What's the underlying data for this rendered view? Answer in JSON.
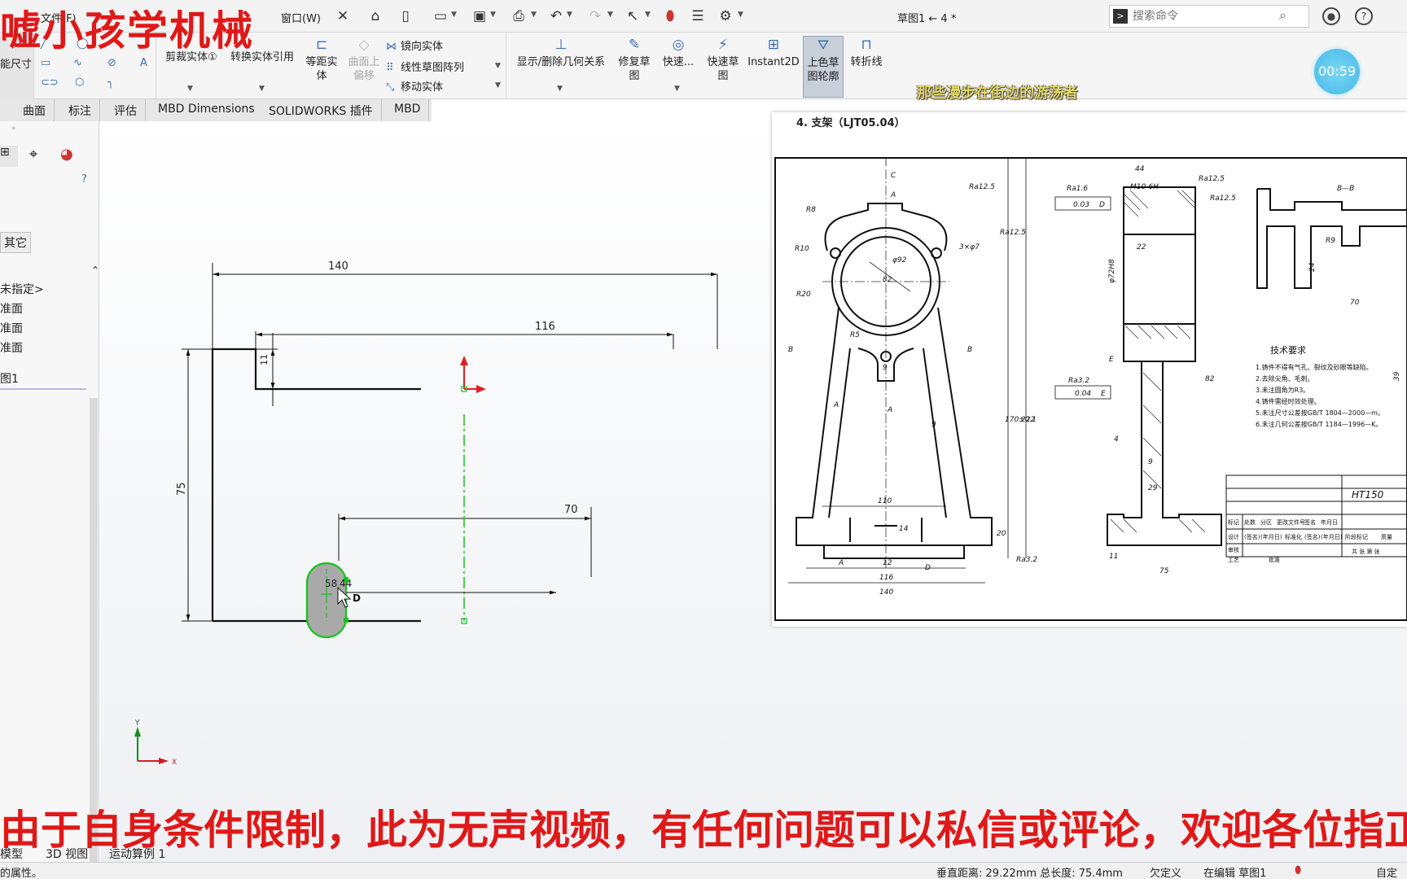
{
  "titlebar": {
    "menu_file": "文件(F)",
    "menu_window": "窗口(W)",
    "document_title": "草图1 ← 4 *",
    "search_placeholder": "搜索命令"
  },
  "overlay": {
    "brand": "嘘小孩学机械",
    "timer": "00:59",
    "lyric": "那些漫步在街边的游荡者",
    "bottom_notice": "由于自身条件限制，此为无声视频，有任何问题可以私信或评论，欢迎各位指正"
  },
  "ribbon": {
    "smart_dimension": "能尺寸",
    "trim_entities": "剪裁实体①",
    "convert_entities": "转换实体引用",
    "offset_entities": "等距实体",
    "offset_on_surface": "曲面上偏移",
    "mirror_entities": "镜向实体",
    "linear_pattern": "线性草图阵列",
    "move_entities": "移动实体",
    "display_relations": "显示/删除几何关系",
    "repair_sketch": "修复草图",
    "quick_snaps": "快速...",
    "rapid_sketch": "快速草图",
    "instant2d": "Instant2D",
    "shaded_sketch": "上色草图轮廓",
    "jog_line": "转折线"
  },
  "tabs": [
    "曲面",
    "标注",
    "评估",
    "MBD Dimensions",
    "SOLIDWORKS 插件",
    "MBD"
  ],
  "left_panel": {
    "other_tab": "其它",
    "tree": [
      "未指定>",
      "准面",
      "准面",
      "准面",
      "图1"
    ]
  },
  "sketch": {
    "dims": {
      "d140": "140",
      "d116": "116",
      "d70": "70",
      "d75": "75",
      "d11": "11",
      "d58": "58",
      "d44": "44"
    },
    "cursor_label": "D"
  },
  "reference_drawing": {
    "title": "4. 支架（LJT05.04）",
    "section_label": "B—B",
    "tech_req_title": "技术要求",
    "tech_req": [
      "1.铸件不得有气孔、裂纹及砂眼等缺陷。",
      "2.去除尖角、毛刺。",
      "3.未注圆角为R3。",
      "4.铸件需经时效处理。",
      "5.未注尺寸公差按GB/T 1804—2000—m。",
      "6.未注几何公差按GB/T 1184—1996—K。"
    ],
    "material": "HT150",
    "labels": {
      "c": "C",
      "a": "A",
      "b": "B",
      "d": "D",
      "e": "E",
      "ra125": "Ra12.5",
      "ra16": "Ra1.6",
      "ra32": "Ra3.2",
      "r8": "R8",
      "r10": "R10",
      "r20": "R20",
      "r5": "R5",
      "r9": "R9",
      "phi92": "φ92",
      "n82": "82",
      "holes": "3×φ7",
      "n9": "9",
      "n110": "110",
      "n14": "14",
      "n12": "12",
      "n116": "116",
      "n140": "140",
      "n20": "20",
      "n170": "170±0.1",
      "n222": "222",
      "n44": "44",
      "m10": "M10-6H",
      "n22": "22",
      "phi72": "φ72H8",
      "tol003": "0.03",
      "tol004": "0.04",
      "n4": "4",
      "n29": "29",
      "n11": "11",
      "n75": "75",
      "n24": "24",
      "n70": "70",
      "n39": "39"
    },
    "title_block": {
      "r1": [
        "标记",
        "处数",
        "分区",
        "更改文件号",
        "签名",
        "年月日"
      ],
      "r2": [
        "设计",
        "(签名)",
        "(年月日)",
        "标准化",
        "(签名)",
        "(年月日)"
      ],
      "r3": [
        "审核",
        "",
        "",
        "",
        "",
        ""
      ],
      "r4": [
        "工艺",
        "",
        "",
        "批准",
        "",
        ""
      ],
      "stage": "阶段标记",
      "weight": "质量",
      "sheets": "共 张  第 张"
    }
  },
  "model_tabs": [
    "模型",
    "3D 视图",
    "运动算例 1"
  ],
  "status": {
    "left": "的属性。",
    "measure": "垂直距离: 29.22mm 总长度: 75.4mm",
    "defined": "欠定义",
    "editing": "在编辑 草图1",
    "units": "自定"
  },
  "axes": {
    "x": "X",
    "y": "Y"
  },
  "colors": {
    "overlay_red": "#e01818",
    "sketch_green": "#17c11d",
    "slot_fill": "#a9a9a9",
    "timer_blue": "#47b9e8"
  }
}
